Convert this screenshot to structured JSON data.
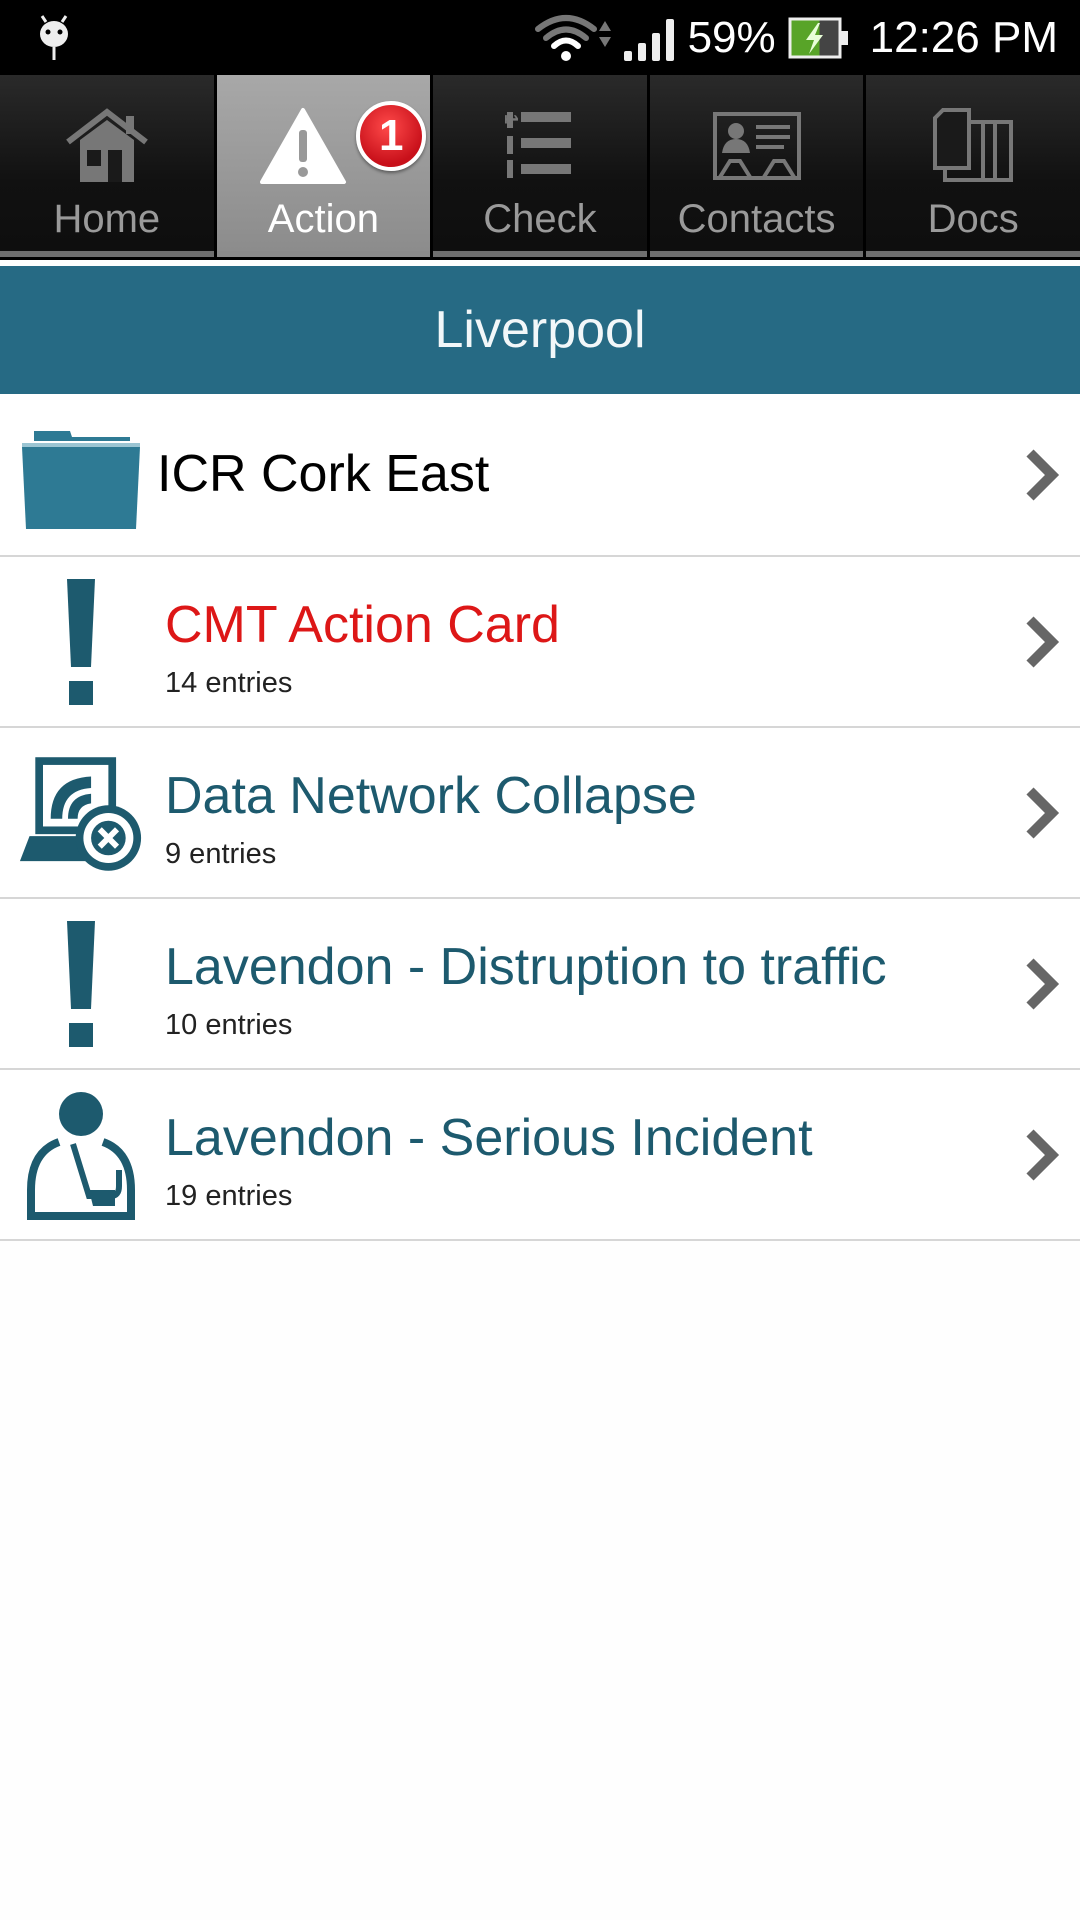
{
  "status_bar": {
    "notification_icon": "android-debug-icon",
    "wifi_icon": "wifi-icon",
    "data_activity_icon": "data-activity-arrows-icon",
    "signal_icon": "cell-signal-icon",
    "battery_percent": "59%",
    "battery_icon": "battery-charging-icon",
    "time": "12:26 PM"
  },
  "tabs": [
    {
      "label": "Home",
      "icon": "home-icon",
      "active": false
    },
    {
      "label": "Action",
      "icon": "warning-triangle-icon",
      "active": true,
      "badge": "1"
    },
    {
      "label": "Check",
      "icon": "numbered-list-icon",
      "active": false
    },
    {
      "label": "Contacts",
      "icon": "contact-card-icon",
      "active": false
    },
    {
      "label": "Docs",
      "icon": "documents-icon",
      "active": false
    }
  ],
  "header": {
    "title": "Liverpool"
  },
  "list": {
    "items": [
      {
        "title": "ICR Cork East",
        "subtitle": "",
        "icon": "folder-icon"
      },
      {
        "title": "CMT Action Card",
        "subtitle": "14 entries",
        "icon": "exclamation-icon"
      },
      {
        "title": "Data Network Collapse",
        "subtitle": "9 entries",
        "icon": "network-error-icon"
      },
      {
        "title": "Lavendon - Distruption to traffic",
        "subtitle": "10 entries",
        "icon": "exclamation-icon"
      },
      {
        "title": "Lavendon - Serious Incident",
        "subtitle": "19 entries",
        "icon": "injured-person-icon"
      }
    ]
  },
  "colors": {
    "header_bg": "#266a84",
    "accent_teal": "#1d5a6e",
    "alert_red": "#dd1717",
    "badge_red": "#d01820"
  }
}
